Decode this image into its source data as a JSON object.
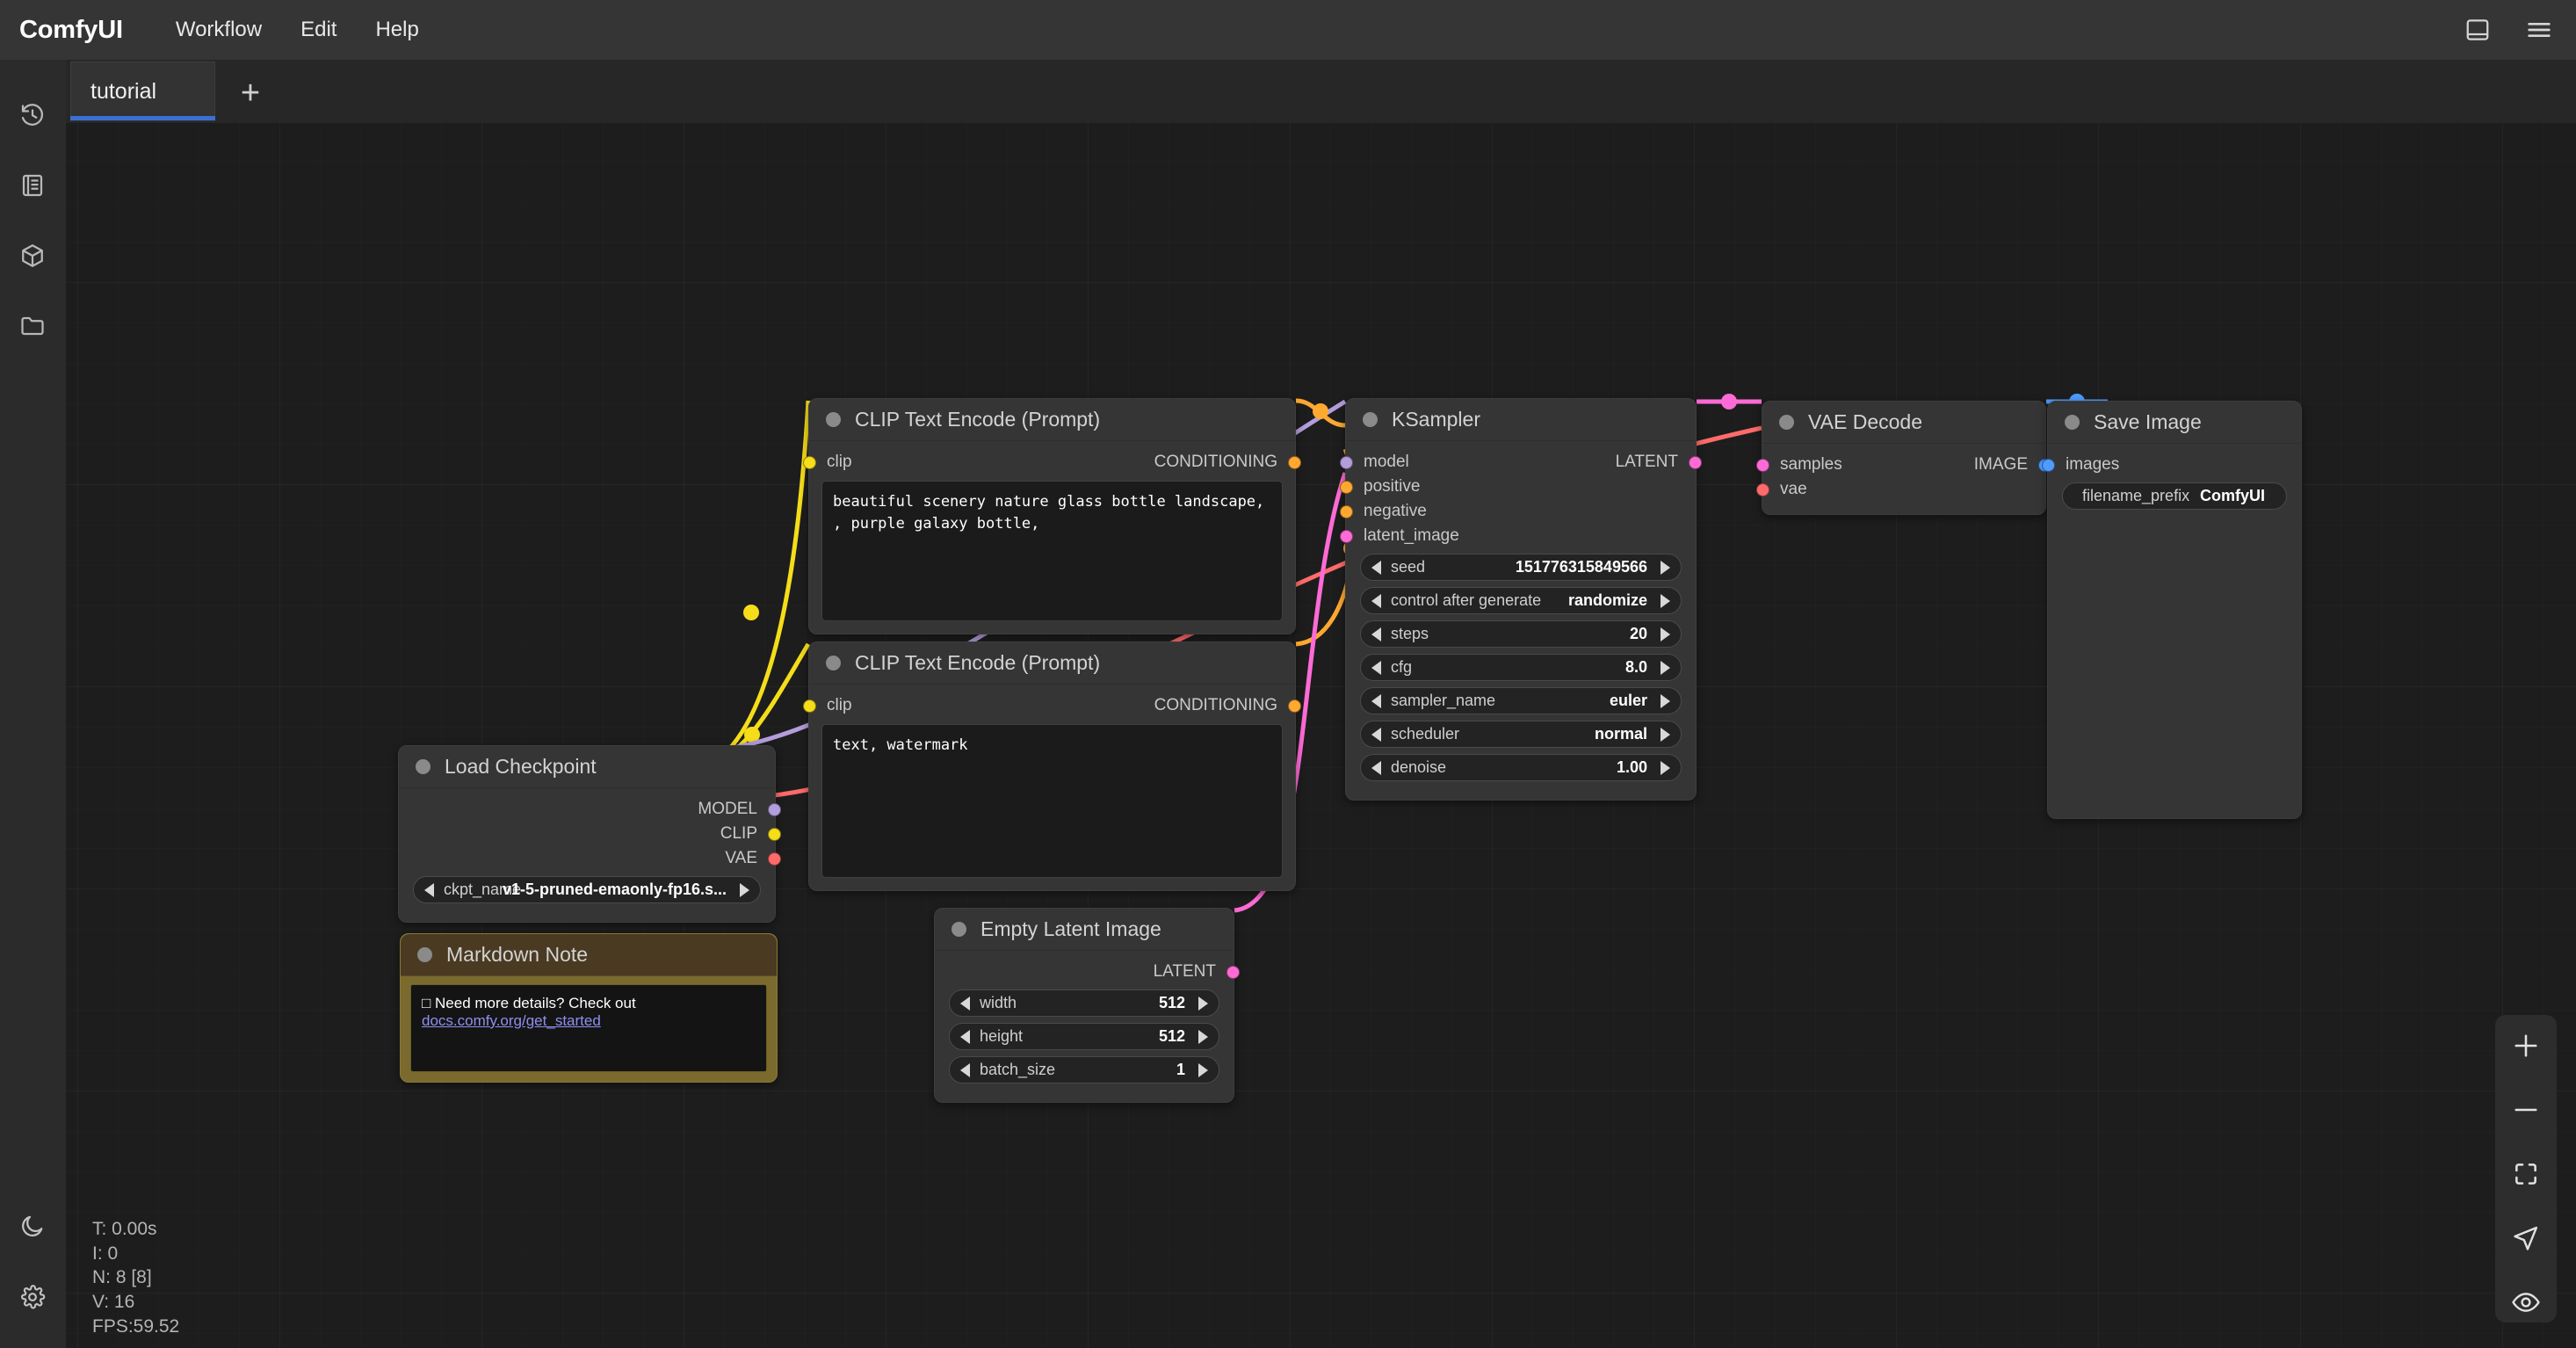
{
  "app": {
    "brand": "ComfyUI",
    "menu": [
      {
        "label": "Workflow"
      },
      {
        "label": "Edit"
      },
      {
        "label": "Help"
      }
    ],
    "topbar_icons": [
      {
        "name": "panel-layout-icon"
      },
      {
        "name": "hamburger-menu-icon"
      }
    ]
  },
  "tabs": {
    "active": "tutorial",
    "new_tab_label": "+"
  },
  "sidebar": {
    "items": [
      {
        "name": "queue-history-icon",
        "label": "Queue"
      },
      {
        "name": "node-library-icon",
        "label": "Node Library"
      },
      {
        "name": "model-library-icon",
        "label": "Model Library"
      },
      {
        "name": "workflows-folder-icon",
        "label": "Workflows"
      }
    ],
    "bottom": [
      {
        "name": "dark-mode-moon-icon",
        "label": "Toggle Theme"
      },
      {
        "name": "settings-gear-icon",
        "label": "Settings"
      }
    ]
  },
  "canvas_toolbar": {
    "buttons": [
      {
        "name": "zoom-in-button",
        "label": "Zoom In"
      },
      {
        "name": "zoom-out-button",
        "label": "Zoom Out"
      },
      {
        "name": "fit-view-button",
        "label": "Fit View"
      },
      {
        "name": "select-mode-button",
        "label": "Select"
      },
      {
        "name": "toggle-link-visibility-button",
        "label": "Toggle Links"
      }
    ]
  },
  "stats": {
    "time": "T: 0.00s",
    "iterations": "I: 0",
    "nodes": "N: 8 [8]",
    "vertices": "V: 16",
    "fps": "FPS:59.52"
  },
  "colors": {
    "accent_blue": "#3b6fd4",
    "clip_yellow": "#f5dd19",
    "model_purple": "#b39ddb",
    "vae_red": "#ff6b6b",
    "conditioning_orange": "#ffa931",
    "latent_pink": "#ff6bd6",
    "image_blue": "#4f9bff"
  },
  "nodes": {
    "clip_positive": {
      "title": "CLIP Text Encode (Prompt)",
      "inputs": [
        {
          "label": "clip",
          "color": "#f5dd19"
        }
      ],
      "outputs": [
        {
          "label": "CONDITIONING",
          "color": "#ffa931"
        }
      ],
      "text": "beautiful scenery nature glass bottle landscape, , purple galaxy bottle,"
    },
    "clip_negative": {
      "title": "CLIP Text Encode (Prompt)",
      "inputs": [
        {
          "label": "clip",
          "color": "#f5dd19"
        }
      ],
      "outputs": [
        {
          "label": "CONDITIONING",
          "color": "#ffa931"
        }
      ],
      "text": "text, watermark"
    },
    "ksampler": {
      "title": "KSampler",
      "inputs": [
        {
          "label": "model",
          "color": "#b39ddb"
        },
        {
          "label": "positive",
          "color": "#ffa931"
        },
        {
          "label": "negative",
          "color": "#ffa931"
        },
        {
          "label": "latent_image",
          "color": "#ff6bd6"
        }
      ],
      "outputs": [
        {
          "label": "LATENT",
          "color": "#ff6bd6"
        }
      ],
      "widgets": [
        {
          "name": "seed",
          "value": "151776315849566"
        },
        {
          "name": "control after generate",
          "value": "randomize"
        },
        {
          "name": "steps",
          "value": "20"
        },
        {
          "name": "cfg",
          "value": "8.0"
        },
        {
          "name": "sampler_name",
          "value": "euler"
        },
        {
          "name": "scheduler",
          "value": "normal"
        },
        {
          "name": "denoise",
          "value": "1.00"
        }
      ]
    },
    "vae_decode": {
      "title": "VAE Decode",
      "inputs": [
        {
          "label": "samples",
          "color": "#ff6bd6"
        },
        {
          "label": "vae",
          "color": "#ff6b6b"
        }
      ],
      "outputs": [
        {
          "label": "IMAGE",
          "color": "#4f9bff"
        }
      ]
    },
    "save_image": {
      "title": "Save Image",
      "inputs": [
        {
          "label": "images",
          "color": "#4f9bff"
        }
      ],
      "widgets": [
        {
          "name": "filename_prefix",
          "value": "ComfyUI"
        }
      ]
    },
    "load_checkpoint": {
      "title": "Load Checkpoint",
      "outputs": [
        {
          "label": "MODEL",
          "color": "#b39ddb"
        },
        {
          "label": "CLIP",
          "color": "#f5dd19"
        },
        {
          "label": "VAE",
          "color": "#ff6b6b"
        }
      ],
      "widgets": [
        {
          "name": "ckpt_name",
          "value": "v1-5-pruned-emaonly-fp16.s..."
        }
      ]
    },
    "empty_latent": {
      "title": "Empty Latent Image",
      "outputs": [
        {
          "label": "LATENT",
          "color": "#ff6bd6"
        }
      ],
      "widgets": [
        {
          "name": "width",
          "value": "512"
        },
        {
          "name": "height",
          "value": "512"
        },
        {
          "name": "batch_size",
          "value": "1"
        }
      ]
    },
    "markdown_note": {
      "title": "Markdown Note",
      "checkbox": "□",
      "text_before": "Need more details? Check out ",
      "link_text": "docs.comfy.org/get_started"
    }
  }
}
